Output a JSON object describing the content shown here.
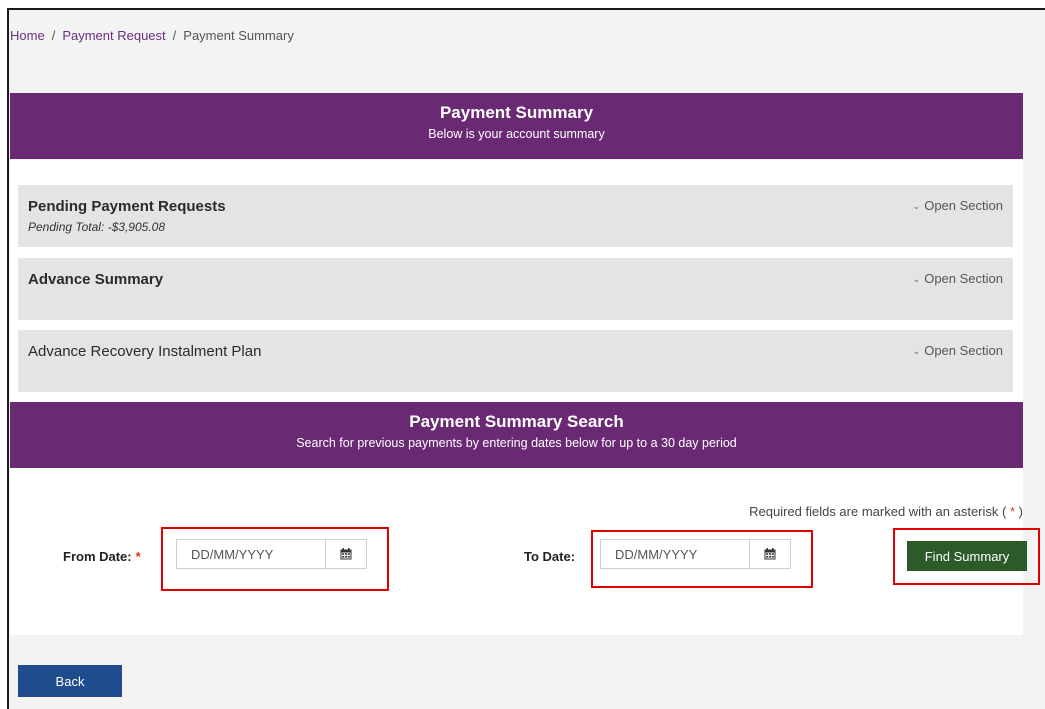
{
  "breadcrumb": {
    "home": "Home",
    "separator": "/",
    "payment_request": "Payment Request",
    "current": "Payment Summary"
  },
  "header_banner": {
    "title": "Payment Summary",
    "subtitle": "Below is your account summary"
  },
  "sections": [
    {
      "title": "Pending Payment Requests",
      "subtitle": "Pending Total: -$3,905.08",
      "toggle_label": "Open Section"
    },
    {
      "title": "Advance Summary",
      "toggle_label": "Open Section"
    },
    {
      "title": "Advance Recovery Instalment Plan",
      "toggle_label": "Open Section"
    }
  ],
  "search_banner": {
    "title": "Payment Summary Search",
    "subtitle": "Search for previous payments by entering dates below for up to a 30 day period"
  },
  "form": {
    "required_note": "Required fields are marked with an asterisk (",
    "required_note_asterisk": "*",
    "required_note_end": ")",
    "from_label": "From Date:",
    "from_asterisk": "*",
    "from_placeholder": "DD/MM/YYYY",
    "to_label": "To Date:",
    "to_placeholder": "DD/MM/YYYY",
    "find_button": "Find Summary"
  },
  "back_button": "Back",
  "icons": {
    "toggle": "chevron-down-icon",
    "calendar": "calendar-icon"
  },
  "colors": {
    "banner": "#6a2a73",
    "find_button": "#2c5a29",
    "back_button": "#1f4c8c",
    "highlight_box": "#e00000",
    "asterisk": "#e0301e"
  }
}
